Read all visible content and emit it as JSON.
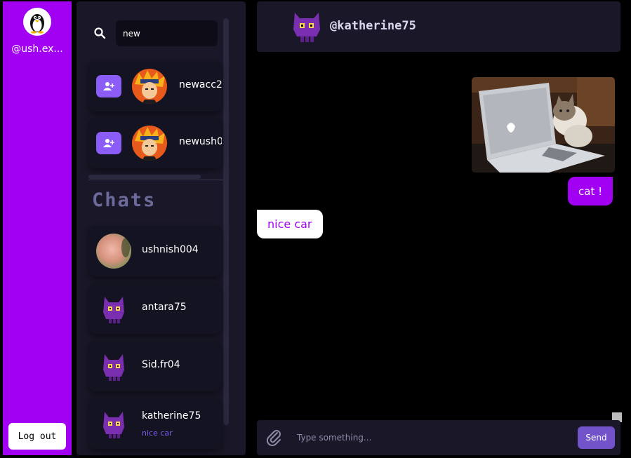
{
  "sidebar": {
    "username": "@ush.ex...",
    "logout_label": "Log out"
  },
  "search": {
    "value": "new",
    "results": [
      {
        "name": "newacc2"
      },
      {
        "name": "newush0"
      }
    ]
  },
  "chats": {
    "heading": "Chats",
    "items": [
      {
        "name": "ushnish004",
        "last_message": ""
      },
      {
        "name": "antara75",
        "last_message": ""
      },
      {
        "name": "Sid.fr04",
        "last_message": ""
      },
      {
        "name": "katherine75",
        "last_message": "nice car"
      }
    ]
  },
  "conversation": {
    "title": "@katherine75",
    "messages": [
      {
        "from": "me",
        "type": "image",
        "alt": "cat"
      },
      {
        "from": "me",
        "type": "text",
        "text": "cat !"
      },
      {
        "from": "them",
        "type": "text",
        "text": "nice car"
      }
    ]
  },
  "composer": {
    "placeholder": "Type something...",
    "send_label": "Send"
  },
  "colors": {
    "accent": "#a100f2",
    "panel": "#1a1828",
    "button": "#8b5cf6"
  }
}
